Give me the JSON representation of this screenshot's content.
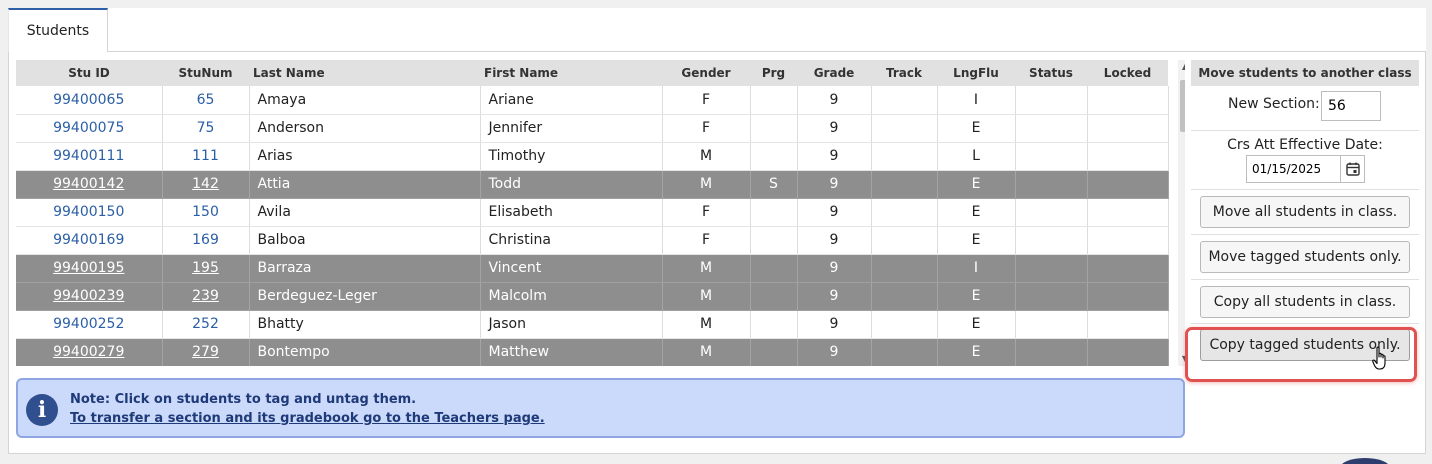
{
  "tabs": [
    {
      "label": "Students"
    }
  ],
  "grid": {
    "columns": [
      "Stu ID",
      "StuNum",
      "Last Name",
      "First Name",
      "Gender",
      "Prg",
      "Grade",
      "Track",
      "LngFlu",
      "Status",
      "Locked"
    ],
    "rows": [
      {
        "stu_id": "99400065",
        "stu_num": "65",
        "last": "Amaya",
        "first": "Ariane",
        "gender": "F",
        "prg": "",
        "grade": "9",
        "track": "",
        "lngflu": "I",
        "status": "",
        "locked": "",
        "tagged": false
      },
      {
        "stu_id": "99400075",
        "stu_num": "75",
        "last": "Anderson",
        "first": "Jennifer",
        "gender": "F",
        "prg": "",
        "grade": "9",
        "track": "",
        "lngflu": "E",
        "status": "",
        "locked": "",
        "tagged": false
      },
      {
        "stu_id": "99400111",
        "stu_num": "111",
        "last": "Arias",
        "first": "Timothy",
        "gender": "M",
        "prg": "",
        "grade": "9",
        "track": "",
        "lngflu": "L",
        "status": "",
        "locked": "",
        "tagged": false
      },
      {
        "stu_id": "99400142",
        "stu_num": "142",
        "last": "Attia",
        "first": "Todd",
        "gender": "M",
        "prg": "S",
        "grade": "9",
        "track": "",
        "lngflu": "E",
        "status": "",
        "locked": "",
        "tagged": true
      },
      {
        "stu_id": "99400150",
        "stu_num": "150",
        "last": "Avila",
        "first": "Elisabeth",
        "gender": "F",
        "prg": "",
        "grade": "9",
        "track": "",
        "lngflu": "E",
        "status": "",
        "locked": "",
        "tagged": false
      },
      {
        "stu_id": "99400169",
        "stu_num": "169",
        "last": "Balboa",
        "first": "Christina",
        "gender": "F",
        "prg": "",
        "grade": "9",
        "track": "",
        "lngflu": "E",
        "status": "",
        "locked": "",
        "tagged": false
      },
      {
        "stu_id": "99400195",
        "stu_num": "195",
        "last": "Barraza",
        "first": "Vincent",
        "gender": "M",
        "prg": "",
        "grade": "9",
        "track": "",
        "lngflu": "I",
        "status": "",
        "locked": "",
        "tagged": true
      },
      {
        "stu_id": "99400239",
        "stu_num": "239",
        "last": "Berdeguez-Leger",
        "first": "Malcolm",
        "gender": "M",
        "prg": "",
        "grade": "9",
        "track": "",
        "lngflu": "E",
        "status": "",
        "locked": "",
        "tagged": true
      },
      {
        "stu_id": "99400252",
        "stu_num": "252",
        "last": "Bhatty",
        "first": "Jason",
        "gender": "M",
        "prg": "",
        "grade": "9",
        "track": "",
        "lngflu": "E",
        "status": "",
        "locked": "",
        "tagged": false
      },
      {
        "stu_id": "99400279",
        "stu_num": "279",
        "last": "Bontempo",
        "first": "Matthew",
        "gender": "M",
        "prg": "",
        "grade": "9",
        "track": "",
        "lngflu": "E",
        "status": "",
        "locked": "",
        "tagged": true
      }
    ]
  },
  "note": {
    "line1": "Note: Click on students to tag and untag them.",
    "line2": "To transfer a section and its gradebook go to the Teachers page."
  },
  "move_panel": {
    "title": "Move students to another class",
    "new_section_label": "New Section:",
    "new_section_value": "56",
    "effective_date_label": "Crs Att Effective Date:",
    "effective_date_value": "01/15/2025",
    "buttons": {
      "move_all": "Move all students in class.",
      "move_tagged": "Move tagged students only.",
      "copy_all": "Copy all students in class.",
      "copy_tagged": "Copy tagged students only."
    }
  },
  "colors": {
    "tagged_row": "#8e8e8e",
    "link": "#2b5fa5",
    "highlight": "#e05252",
    "note_bg": "#cbd9fb"
  }
}
